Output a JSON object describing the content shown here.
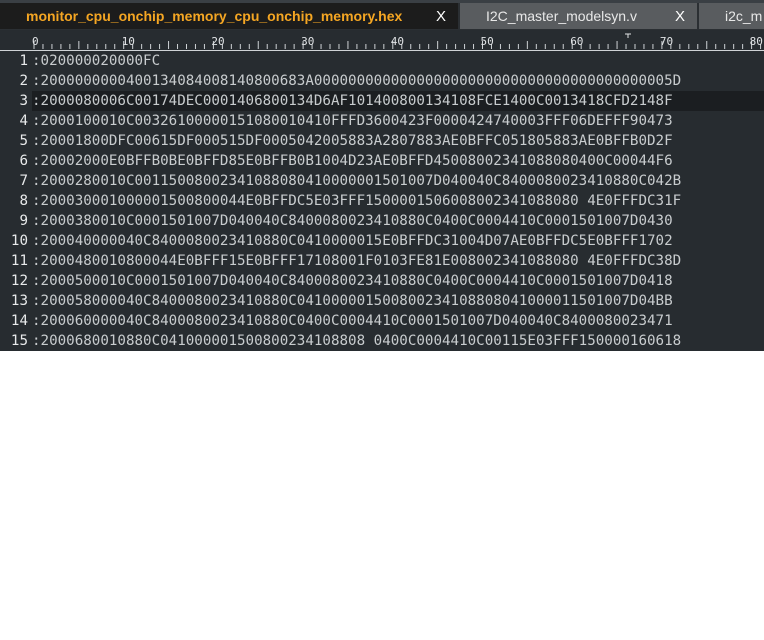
{
  "tabs": [
    {
      "label": "monitor_cpu_onchip_memory_cpu_onchip_memory.hex",
      "active": true
    },
    {
      "label": "I2C_master_modelsyn.v",
      "active": false
    },
    {
      "label": "i2c_m",
      "active": false
    }
  ],
  "close_glyph": "X",
  "ruler_labels": [
    "0",
    "10",
    "20",
    "30",
    "40",
    "50",
    "60",
    "70",
    "80"
  ],
  "current_line": 3,
  "lines": [
    {
      "n": "1",
      "text": ":020000020000FC"
    },
    {
      "n": "2",
      "text": ":2000000000400134084008140800683A000000000000000000000000000000000000000005D"
    },
    {
      "n": "3",
      "text": ":2000080006C00174DEC0001406800134D6AF101400800134108FCE1400C0013418CFD2148F"
    },
    {
      "n": "4",
      "text": ":2000100010C00326100000151080010410FFFD3600423F0000424740003FFF06DEFFF90473"
    },
    {
      "n": "5",
      "text": ":20001800DFC00615DF000515DF0005042005883A2807883AE0BFFC051805883AE0BFFB0D2F"
    },
    {
      "n": "6",
      "text": ":20002000E0BFFB0BE0BFFD85E0BFFB0B1004D23AE0BFFD45008002341088080400C00044F6"
    },
    {
      "n": "7",
      "text": ":2000280010C00115008002341088080410000001501007D040040C8400080023410880C042B"
    },
    {
      "n": "8",
      "text": ":200030001000001500800044E0BFFDC5E03FFF1500001506008002341088080 4E0FFFDC31F"
    },
    {
      "n": "9",
      "text": ":2000380010C0001501007D040040C8400080023410880C0400C0004410C0001501007D0430"
    },
    {
      "n": "10",
      "text": ":200040000040C8400080023410880C0410000015E0BFFDC31004D07AE0BFFDC5E0BFFF1702"
    },
    {
      "n": "11",
      "text": ":2000480010800044E0BFFF15E0BFFF17108001F0103FE81E008002341088080 4E0FFFDC38D"
    },
    {
      "n": "12",
      "text": ":2000500010C0001501007D040040C8400080023410880C0400C0004410C0001501007D0418"
    },
    {
      "n": "13",
      "text": ":200058000040C8400080023410880C041000001500800234108808041000011501007D04BB"
    },
    {
      "n": "14",
      "text": ":200060000040C8400080023410880C0400C0004410C0001501007D040040C8400080023471"
    },
    {
      "n": "15",
      "text": ":2000680010880C041000001500800234108808 0400C0004410C00115E03FFF150000160618"
    }
  ]
}
